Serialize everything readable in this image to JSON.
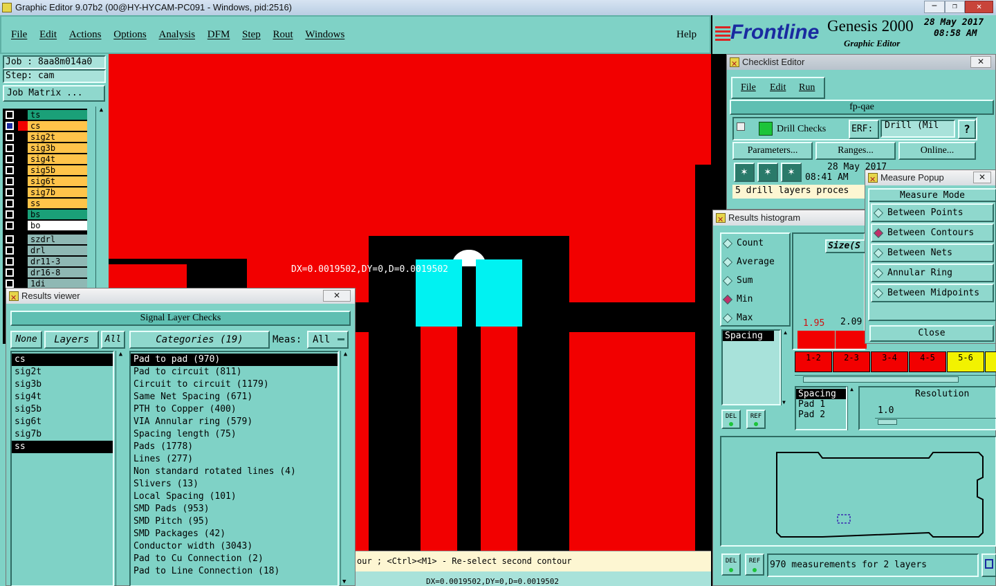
{
  "titlebar": {
    "title": "Graphic Editor 9.07b2 (00@HY-HYCAM-PC091 - Windows, pid:2516)"
  },
  "menu": {
    "items": [
      "File",
      "Edit",
      "Actions",
      "Options",
      "Analysis",
      "DFM",
      "Step",
      "Rout",
      "Windows"
    ],
    "help": "Help"
  },
  "brand": {
    "logo": "Frontline",
    "product": "Genesis 2000",
    "subtitle": "Graphic Editor",
    "date": "28 May 2017",
    "time": "08:58 AM"
  },
  "job": {
    "job": "Job : 8aa8m014a0",
    "step": "Step: cam",
    "matrix_button": "Job Matrix ..."
  },
  "layers": [
    {
      "name": "ts",
      "color": "#1aa078"
    },
    {
      "name": "cs",
      "color": "#ffc44a"
    },
    {
      "name": "sig2t",
      "color": "#ffc44a"
    },
    {
      "name": "sig3b",
      "color": "#ffc44a"
    },
    {
      "name": "sig4t",
      "color": "#ffc44a"
    },
    {
      "name": "sig5b",
      "color": "#ffc44a"
    },
    {
      "name": "sig6t",
      "color": "#ffc44a"
    },
    {
      "name": "sig7b",
      "color": "#ffc44a"
    },
    {
      "name": "ss",
      "color": "#ffc44a"
    },
    {
      "name": "bs",
      "color": "#1aa078"
    },
    {
      "name": "bo",
      "color": "#ffffff"
    }
  ],
  "drill_layers": [
    {
      "name": "szdrl"
    },
    {
      "name": "drl"
    },
    {
      "name": "dr11-3"
    },
    {
      "name": "dr16-8"
    },
    {
      "name": "1di"
    }
  ],
  "canvas": {
    "measure_label": "DX=0.0019502,DY=0,D=0.0019502"
  },
  "status": {
    "hint": "our ; <Ctrl><M1> - Re-select second contour",
    "coords": "DX=0.0019502,DY=0,D=0.0019502"
  },
  "results_viewer": {
    "title": "Results viewer",
    "header": "Signal Layer Checks",
    "none": "None",
    "layers": "Layers",
    "all": "All",
    "categories": "Categories (19)",
    "meas_label": "Meas:",
    "meas_value": "All",
    "layer_list": [
      "cs",
      "sig2t",
      "sig3b",
      "sig4t",
      "sig5b",
      "sig6t",
      "sig7b",
      "ss"
    ],
    "category_list": [
      "Pad to pad (970)",
      "Pad to circuit (811)",
      "Circuit to circuit (1179)",
      "Same Net Spacing (671)",
      "PTH to Copper (400)",
      "VIA Annular ring (579)",
      "Spacing length (75)",
      "Pads (1778)",
      "Lines (277)",
      "Non standard rotated lines (4)",
      "Slivers (13)",
      "Local Spacing (101)",
      "SMD Pads (953)",
      "SMD Pitch (95)",
      "SMD Packages (42)",
      "Conductor width (3043)",
      "Pad to Cu Connection (2)",
      "Pad to Line Connection (18)"
    ]
  },
  "checklist": {
    "title": "Checklist Editor",
    "menu": [
      "File",
      "Edit",
      "Run"
    ],
    "name": "fp-qae",
    "check_name": "Drill Checks",
    "erf_label": "ERF:",
    "erf_value": "Drill (Mil",
    "help": "?",
    "parameters": "Parameters...",
    "ranges": "Ranges...",
    "online": "Online...",
    "run_date": "28 May 2017",
    "run_time": "08:41 AM",
    "status_text": "5 drill layers proces"
  },
  "histogram": {
    "title": "Results histogram",
    "options": [
      "Count",
      "Average",
      "Sum",
      "Min",
      "Max"
    ],
    "selected": "Min",
    "size_label": "Size(S",
    "bar_labels": [
      "1.95",
      "2.09"
    ],
    "ranges": [
      "1-2",
      "2-3",
      "3-4",
      "4-5",
      "5-6"
    ],
    "attr_list": [
      "Spacing"
    ],
    "sort_list": [
      "Spacing",
      "Pad 1",
      "Pad 2"
    ],
    "resolution_label": "Resolution",
    "resolution_value": "1.0",
    "del": "DEL",
    "ref": "REF",
    "summary": "970 measurements for 2 layers"
  },
  "measure": {
    "title": "Measure Popup",
    "mode_label": "Measure Mode",
    "modes": [
      "Between Points",
      "Between Contours",
      "Between Nets",
      "Annular Ring",
      "Between Midpoints"
    ],
    "selected": "Between Contours",
    "close": "Close"
  }
}
